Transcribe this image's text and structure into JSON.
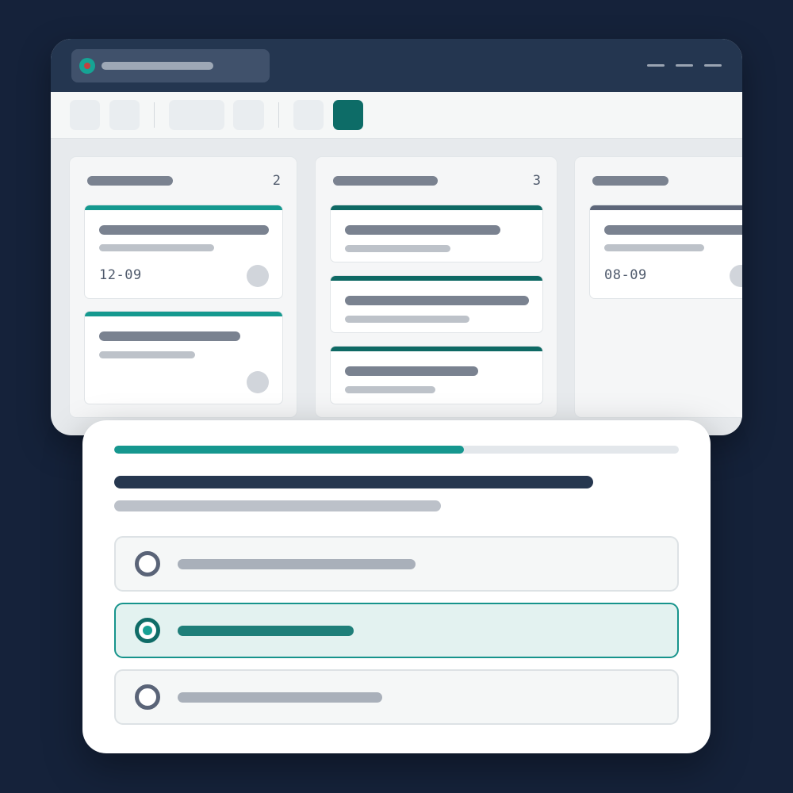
{
  "window": {
    "controls": [
      "window-control-1",
      "window-control-2",
      "window-control-3"
    ]
  },
  "toolbar": {
    "buttons": [
      "toolbar-button-1",
      "toolbar-button-2",
      "toolbar-button-3",
      "toolbar-button-4",
      "toolbar-button-5",
      "toolbar-button-6"
    ],
    "active_index": 5
  },
  "board": {
    "columns": [
      {
        "count": "2",
        "cards": [
          {
            "date": "12-09"
          },
          {
            "date": ""
          }
        ]
      },
      {
        "count": "3",
        "cards": [
          {
            "date": ""
          },
          {
            "date": ""
          },
          {
            "date": ""
          }
        ]
      },
      {
        "count": "",
        "cards": [
          {
            "date": "08-09"
          }
        ]
      }
    ]
  },
  "dialog": {
    "progress": 0.62,
    "selected_option_index": 1,
    "option_count": 3
  },
  "colors": {
    "background": "#15223a",
    "titlebar": "#243650",
    "accent": "#16978f",
    "accent_dark": "#0d6c67",
    "heading": "#26374f"
  }
}
